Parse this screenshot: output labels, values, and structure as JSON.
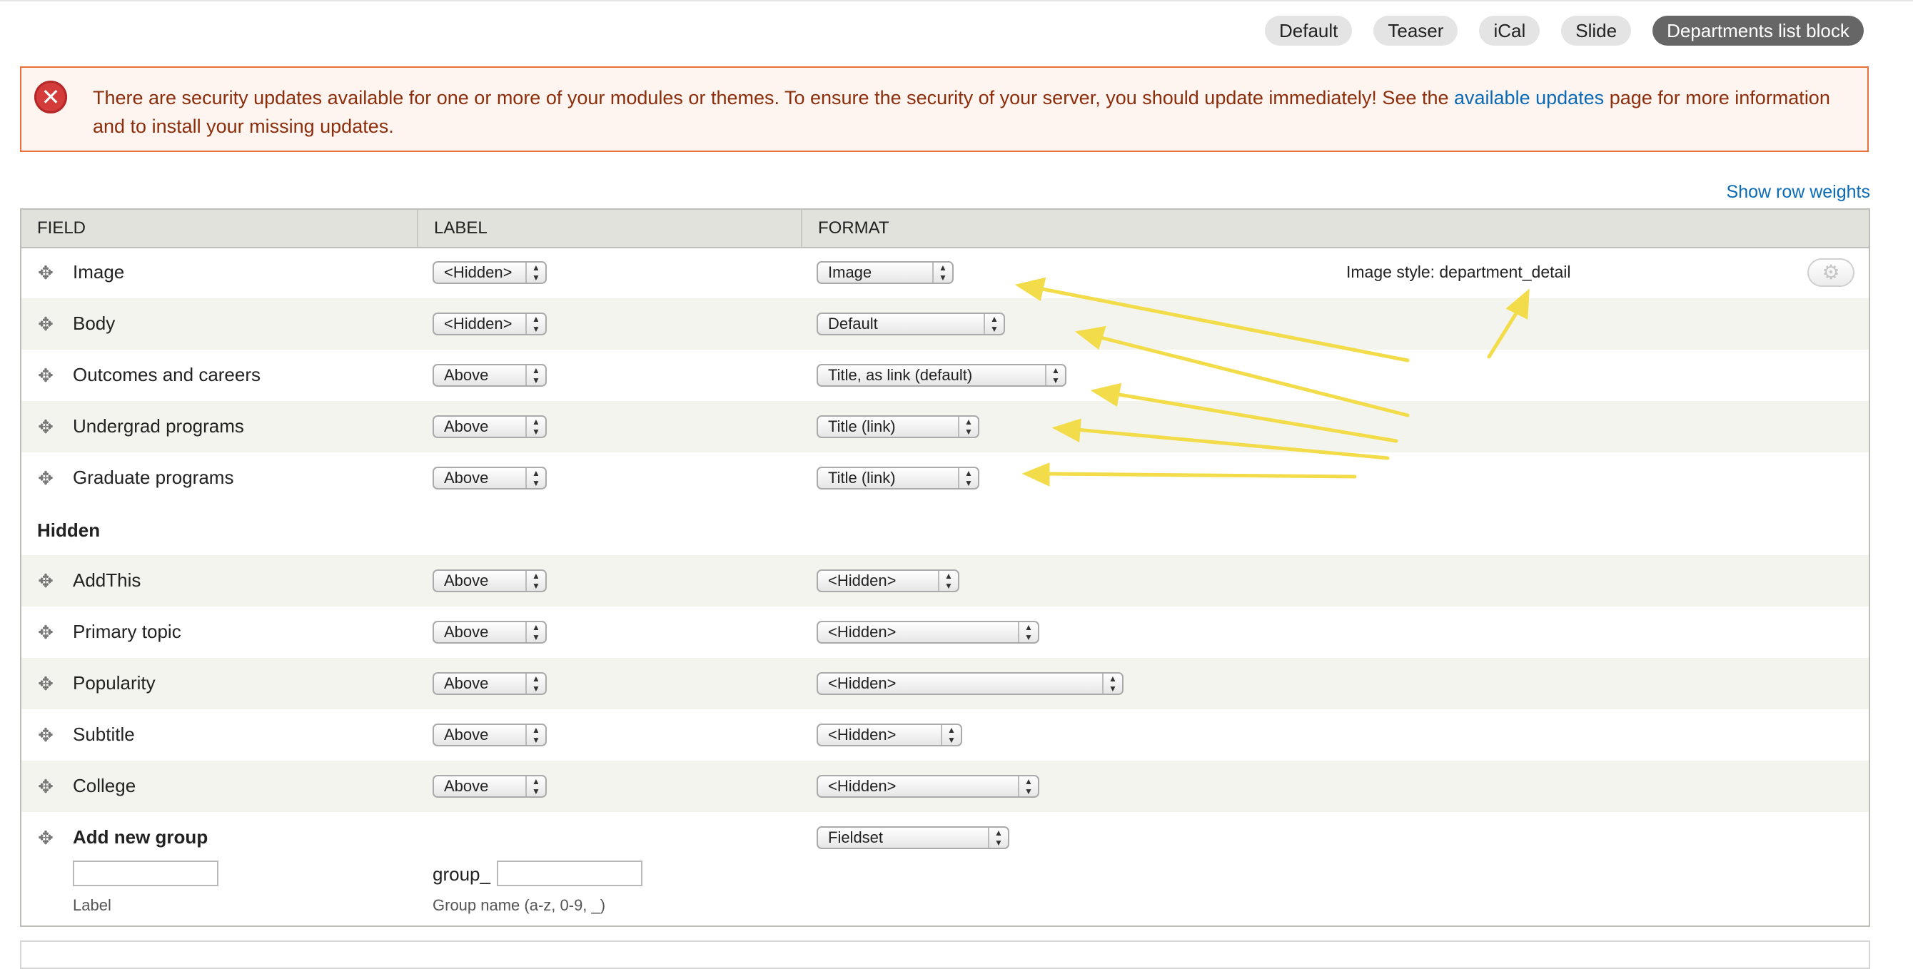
{
  "tabs": [
    {
      "label": "Default",
      "active": false
    },
    {
      "label": "Teaser",
      "active": false
    },
    {
      "label": "iCal",
      "active": false
    },
    {
      "label": "Slide",
      "active": false
    },
    {
      "label": "Departments list block",
      "active": true
    }
  ],
  "message": {
    "before": "There are security updates available for one or more of your modules or themes. To ensure the security of your server, you should update immediately! See the ",
    "link": "available updates",
    "after": " page for more information and to install your missing updates."
  },
  "show_row_weights": "Show row weights",
  "table": {
    "headers": {
      "field": "FIELD",
      "label": "LABEL",
      "format": "FORMAT"
    },
    "rows": [
      {
        "field": "Image",
        "label": "<Hidden>",
        "format": "Image",
        "summary": "Image style: department_detail"
      },
      {
        "field": "Body",
        "label": "<Hidden>",
        "format": "Default"
      },
      {
        "field": "Outcomes and careers",
        "label": "Above",
        "format": "Title, as link (default)"
      },
      {
        "field": "Undergrad programs",
        "label": "Above",
        "format": "Title (link)"
      },
      {
        "field": "Graduate programs",
        "label": "Above",
        "format": "Title (link)"
      }
    ],
    "hidden_region": "Hidden",
    "hidden_rows": [
      {
        "field": "AddThis",
        "label": "Above",
        "format": "<Hidden>"
      },
      {
        "field": "Primary topic",
        "label": "Above",
        "format": "<Hidden>"
      },
      {
        "field": "Popularity",
        "label": "Above",
        "format": "<Hidden>"
      },
      {
        "field": "Subtitle",
        "label": "Above",
        "format": "<Hidden>"
      },
      {
        "field": "College",
        "label": "Above",
        "format": "<Hidden>"
      }
    ],
    "new_group": {
      "title": "Add new group",
      "format": "Fieldset",
      "label_input_value": "",
      "label_caption": "Label",
      "group_prefix": "group_",
      "group_name_value": "",
      "group_name_caption": "Group name (a-z, 0-9, _)"
    }
  },
  "colors": {
    "error_border": "#e8713b",
    "error_bg": "#fef4f0",
    "error_text": "#8c2e0b",
    "link": "#0a6ab6",
    "active_tab": "#666666",
    "annotation_arrow": "#f2dc4a"
  }
}
